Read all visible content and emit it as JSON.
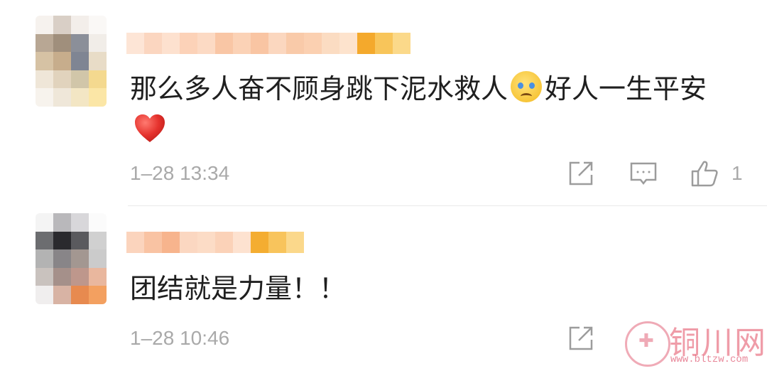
{
  "comments": [
    {
      "text_part1": "那么多人奋不顾身跳下泥水救人",
      "emoji": "crying-face",
      "text_part2": "好人一生平安",
      "extra_emoji": "heart",
      "time": "1–28 13:34",
      "like_count": "1"
    },
    {
      "text": "团结就是力量！！",
      "time": "1–28 10:46"
    }
  ],
  "watermark": {
    "text": "铜川网",
    "url": "www.bltzw.com"
  },
  "icons": {
    "share": "share-icon",
    "reply": "reply-icon",
    "like": "thumbs-up-icon"
  },
  "colors": {
    "time_gray": "#a9a9a9",
    "heart_red": "#e5322d",
    "name_blur_orange": "#f6b13a"
  }
}
